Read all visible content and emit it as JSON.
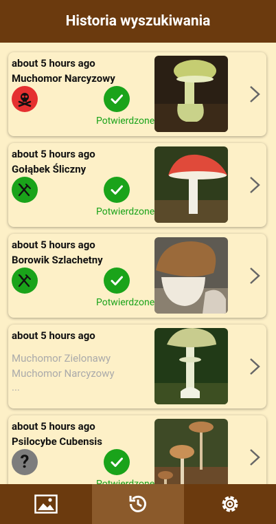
{
  "header": {
    "title": "Historia wyszukiwania"
  },
  "colors": {
    "brand": "#6b3a0e",
    "active_tab": "#8b5a2b",
    "background": "#fdf0c7",
    "confirmed": "#1aa31a",
    "toxic": "#e53030",
    "unknown": "#7d7d7d"
  },
  "history": [
    {
      "time": "about 5 hours ago",
      "name": "Muchomor Narcyzowy",
      "badge": "skull-icon",
      "status": "Potwierdzone"
    },
    {
      "time": "about 5 hours ago",
      "name": "Gołąbek Śliczny",
      "badge": "fork-knife-icon",
      "status": "Potwierdzone"
    },
    {
      "time": "about 5 hours ago",
      "name": "Borowik Szlachetny",
      "badge": "fork-knife-icon",
      "status": "Potwierdzone"
    },
    {
      "time": "about 5 hours ago",
      "candidates": [
        "Muchomor Zielonawy",
        "Muchomor Narcyzowy",
        "..."
      ]
    },
    {
      "time": "about 5 hours ago",
      "name": "Psilocybe Cubensis",
      "badge": "question-mark-icon",
      "badge_text": "?",
      "status": "Potwierdzone"
    }
  ],
  "nav": [
    {
      "icon": "gallery-icon",
      "active": false
    },
    {
      "icon": "history-icon",
      "active": true
    },
    {
      "icon": "settings-gear-icon",
      "active": false
    }
  ]
}
